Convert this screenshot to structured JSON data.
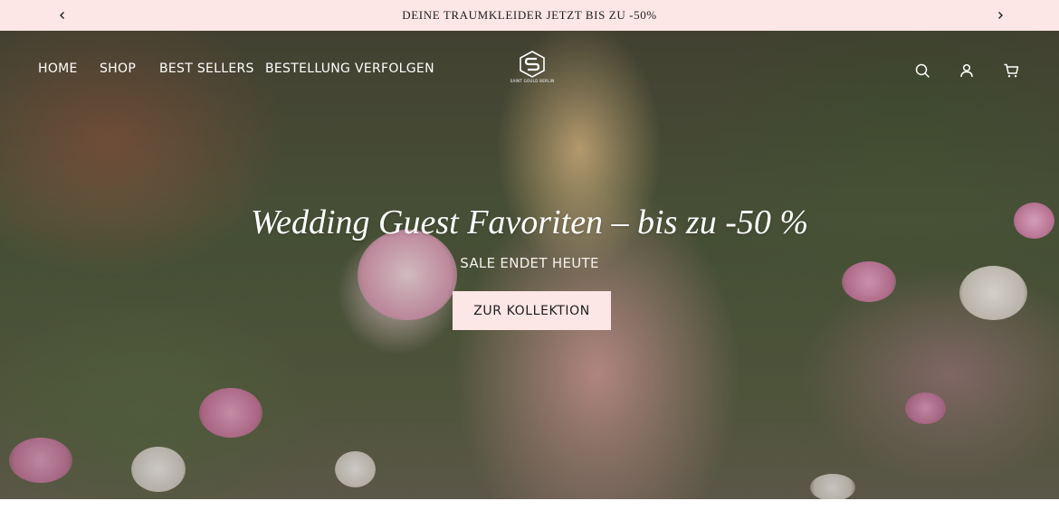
{
  "announcement": {
    "text": "DEINE TRAUMKLEIDER JETZT BIS ZU -50%",
    "prev_icon": "chevron-left-icon",
    "next_icon": "chevron-right-icon"
  },
  "nav": {
    "items": [
      {
        "label": "HOME"
      },
      {
        "label": "SHOP"
      },
      {
        "label": "BEST SELLERS"
      },
      {
        "label": "BESTELLUNG VERFOLGEN"
      }
    ],
    "logo_caption": "SAINT GOULD BERLIN",
    "icons": [
      "search-icon",
      "account-icon",
      "cart-icon"
    ]
  },
  "hero": {
    "title": "Wedding Guest Favoriten – bis zu -50 %",
    "subtitle": "SALE ENDET HEUTE",
    "cta_label": "ZUR KOLLEKTION"
  },
  "colors": {
    "announcement_bg": "#fde6e6",
    "cta_bg": "#fde6e6",
    "text_dark": "#1e1e1e",
    "text_light": "#ffffff"
  }
}
